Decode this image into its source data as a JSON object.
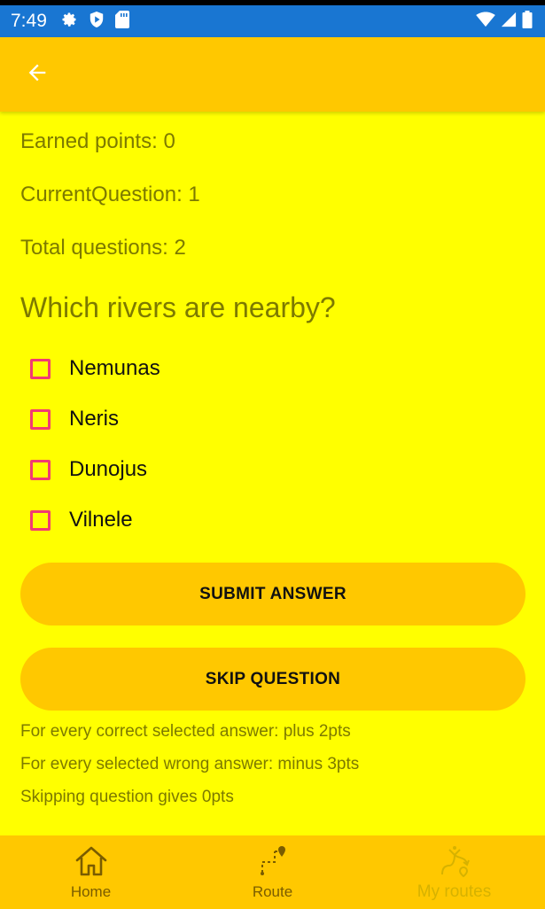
{
  "status_bar": {
    "time": "7:49",
    "icons_left": [
      "settings-icon",
      "shield-icon",
      "sd-card-icon"
    ],
    "icons_right": [
      "wifi-icon",
      "signal-icon",
      "battery-icon"
    ],
    "background_color": "#1976d2"
  },
  "app_bar": {
    "back_icon": "arrow-back-icon",
    "background_color": "#ffc800"
  },
  "quiz": {
    "earned_points": "Earned points: 0",
    "current_question": "CurrentQuestion: 1",
    "total_questions": "Total questions: 2",
    "question": "Which rivers are nearby?",
    "options": [
      {
        "label": "Nemunas",
        "checked": false
      },
      {
        "label": "Neris",
        "checked": false
      },
      {
        "label": "Dunojus",
        "checked": false
      },
      {
        "label": "Vilnele",
        "checked": false
      }
    ],
    "submit_label": "SUBMIT ANSWER",
    "skip_label": "SKIP QUESTION",
    "rules": [
      "For every correct selected answer: plus 2pts",
      "For every selected wrong answer: minus 3pts",
      "Skipping question gives 0pts"
    ]
  },
  "bottom_nav": {
    "items": [
      {
        "label": "Home",
        "icon": "home-icon",
        "active": true
      },
      {
        "label": "Route",
        "icon": "route-icon",
        "active": true
      },
      {
        "label": "My routes",
        "icon": "my-routes-icon",
        "active": false
      }
    ]
  },
  "colors": {
    "page_background": "#ffff00",
    "accent": "#ffc800",
    "checkbox": "#f23a73",
    "muted_text": "#7d7a00"
  }
}
